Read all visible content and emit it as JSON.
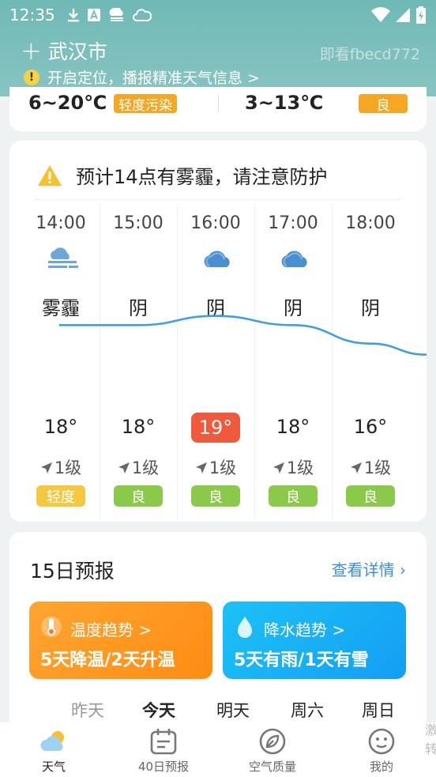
{
  "status_bar": {
    "time": "12:35",
    "icons": [
      "download-icon",
      "a-box-icon",
      "cloud-rain-icon",
      "cloud-outline-icon"
    ],
    "right_icons": [
      "wifi-icon",
      "signal-icon",
      "battery-charging-icon"
    ]
  },
  "header": {
    "add_symbol": "+",
    "city": "武汉市",
    "watermark": "即看fbecd772",
    "location_prompt": "开启定位，播报精准天气信息 >"
  },
  "today_card": {
    "today_temp": "6~20℃",
    "today_aqi": "轻度污染",
    "tomorrow_temp": "3~13℃",
    "tomorrow_aqi": "良"
  },
  "hourly_card": {
    "alert": "预计14点有雾霾，请注意防护",
    "hours": [
      {
        "time": "14:00",
        "icon": "haze-icon",
        "condition": "雾霾",
        "temp": "18°",
        "wind": "1级",
        "aqi": "轻度",
        "aqi_color": "#f5c842",
        "highlight": false
      },
      {
        "time": "15:00",
        "icon": "none",
        "condition": "阴",
        "temp": "18°",
        "wind": "1级",
        "aqi": "良",
        "aqi_color": "#8bc94a",
        "highlight": false
      },
      {
        "time": "16:00",
        "icon": "overcast-icon",
        "condition": "阴",
        "temp": "19°",
        "wind": "1级",
        "aqi": "良",
        "aqi_color": "#8bc94a",
        "highlight": true
      },
      {
        "time": "17:00",
        "icon": "overcast-icon",
        "condition": "阴",
        "temp": "18°",
        "wind": "1级",
        "aqi": "良",
        "aqi_color": "#8bc94a",
        "highlight": false
      },
      {
        "time": "18:00",
        "icon": "none",
        "condition": "阴",
        "temp": "16°",
        "wind": "1级",
        "aqi": "良",
        "aqi_color": "#8bc94a",
        "highlight": false
      }
    ],
    "temp_curve_values": [
      18,
      18,
      19,
      18,
      16
    ]
  },
  "forecast_card": {
    "title": "15日预报",
    "more": "查看详情",
    "temp_trend_label": "温度趋势 >",
    "temp_trend_value": "5天降温/2天升温",
    "rain_trend_label": "降水趋势 >",
    "rain_trend_value": "5天有雨/1天有雪",
    "days": [
      "昨天",
      "今天",
      "明天",
      "周六",
      "周日"
    ]
  },
  "bottom_nav": [
    {
      "label": "天气",
      "icon": "weather-icon",
      "active": true
    },
    {
      "label": "40日预报",
      "icon": "calendar-icon",
      "active": false
    },
    {
      "label": "空气质量",
      "icon": "leaf-icon",
      "active": false
    },
    {
      "label": "我的",
      "icon": "profile-icon",
      "active": false
    }
  ],
  "overflow_text": "激转",
  "colors": {
    "header_bg": "#7fc0bd",
    "aqi_mild": "#f5a623",
    "aqi_good": "#8bc94a",
    "highlight_temp": "#ef5a3d",
    "link_blue": "#3a8ee6",
    "temp_trend_bg": "#ff9a1f",
    "rain_trend_bg": "#1eb0f5",
    "curve": "#3c9fe6"
  }
}
